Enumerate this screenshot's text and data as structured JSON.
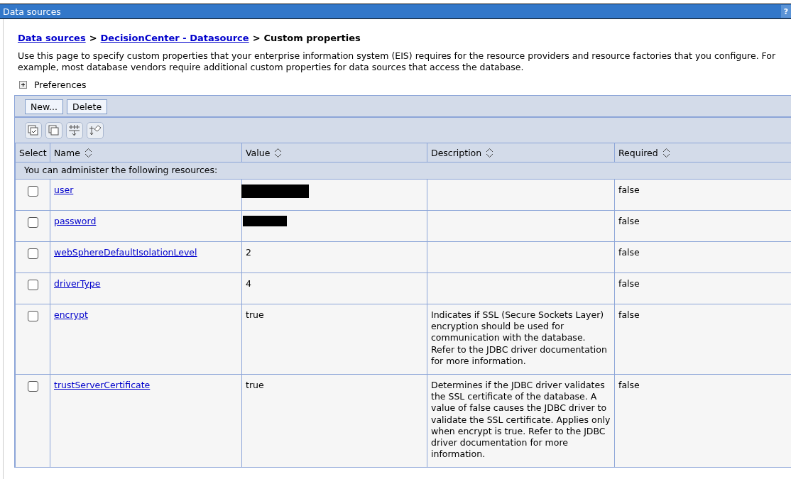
{
  "window": {
    "title": "Data sources",
    "help": "?"
  },
  "breadcrumb": {
    "links": [
      "Data sources",
      "DecisionCenter - Datasource"
    ],
    "current": "Custom properties",
    "separator": ">"
  },
  "intro": "Use this page to specify custom properties that your enterprise information system (EIS) requires for the resource providers and resource factories that you configure. For example, most database vendors require additional custom properties for data sources that access the database.",
  "preferences": {
    "label": "Preferences",
    "expanded": false
  },
  "buttons": [
    "New...",
    "Delete"
  ],
  "tools": [
    {
      "kind": "select-all"
    },
    {
      "kind": "deselect-all"
    },
    {
      "kind": "filter"
    },
    {
      "kind": "clear-filter"
    }
  ],
  "table": {
    "columns": [
      "Select",
      "Name",
      "Value",
      "Description",
      "Required"
    ],
    "group_label": "You can administer the following resources:",
    "rows": [
      {
        "checked": false,
        "name": "user",
        "redacted": true,
        "value": "",
        "description": "",
        "required": "false"
      },
      {
        "checked": false,
        "name": "password",
        "redacted": true,
        "value": "",
        "description": "",
        "required": "false"
      },
      {
        "checked": false,
        "name": "webSphereDefaultIsolationLevel",
        "redacted": false,
        "value": "2",
        "description": "",
        "required": "false"
      },
      {
        "checked": false,
        "name": "driverType",
        "redacted": false,
        "value": "4",
        "description": "",
        "required": "false"
      },
      {
        "checked": false,
        "name": "encrypt",
        "redacted": false,
        "value": "true",
        "description": "Indicates if SSL (Secure Sockets Layer) encryption should be used for communication with the database. Refer to the JDBC driver documentation for more information.",
        "required": "false"
      },
      {
        "checked": false,
        "name": "trustServerCertificate",
        "redacted": false,
        "value": "true",
        "description": "Determines if the JDBC driver validates the SSL certificate of the database. A value of false causes the JDBC driver to validate the SSL certificate. Applies only when encrypt is true. Refer to the JDBC driver documentation for more information.",
        "required": "false"
      }
    ]
  }
}
